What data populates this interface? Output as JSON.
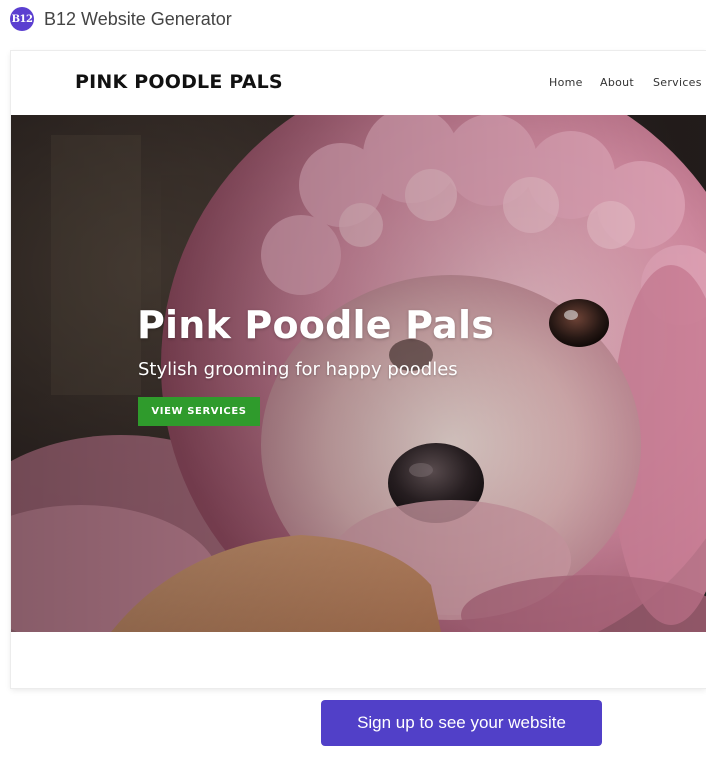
{
  "app": {
    "logo_text": "B12",
    "title": "B12 Website Generator"
  },
  "site": {
    "logo": "PINK POODLE PALS",
    "nav": {
      "home": "Home",
      "about": "About",
      "services": "Services"
    },
    "hero": {
      "title": "Pink Poodle Pals",
      "subtitle": "Stylish grooming for happy poodles",
      "cta_label": "VIEW SERVICES"
    }
  },
  "signup_label": "Sign up to see your website",
  "colors": {
    "app_logo": "#5b3fd0",
    "cta_green": "#2f9b2c",
    "signup_purple": "#5140c8",
    "poodle_pink": "#e8a9bd"
  }
}
